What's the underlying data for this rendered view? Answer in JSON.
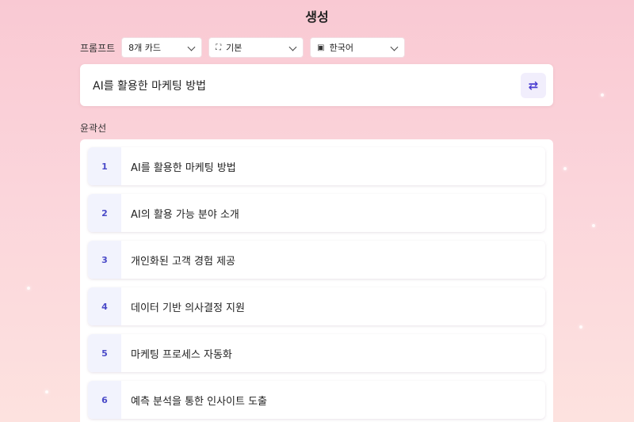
{
  "header": {
    "title": "생성"
  },
  "prompt": {
    "label": "프롬프트",
    "cards_select": "8개 카드",
    "theme_select": "기본",
    "language_select": "한국어"
  },
  "topic": {
    "value": "AI를 활용한 마케팅 방법"
  },
  "outline": {
    "label": "윤곽선",
    "items": [
      {
        "num": "1",
        "text": "AI를 활용한 마케팅 방법"
      },
      {
        "num": "2",
        "text": "AI의 활용 가능 분야 소개"
      },
      {
        "num": "3",
        "text": "개인화된 고객 경험 제공"
      },
      {
        "num": "4",
        "text": "데이터 기반 의사결정 지원"
      },
      {
        "num": "5",
        "text": "마케팅 프로세스 자동화"
      },
      {
        "num": "6",
        "text": "예측 분석을 통한 인사이트 도출"
      }
    ]
  },
  "icons": {
    "theme": "layout-icon",
    "language": "translate-icon",
    "refresh": "refresh-icon",
    "dropdown": "chevron-down-icon"
  },
  "colors": {
    "background_top": "#f9c9d3",
    "background_bottom": "#fde2df",
    "accent": "#4b3fd1",
    "number_bg": "#f2f3fd"
  }
}
